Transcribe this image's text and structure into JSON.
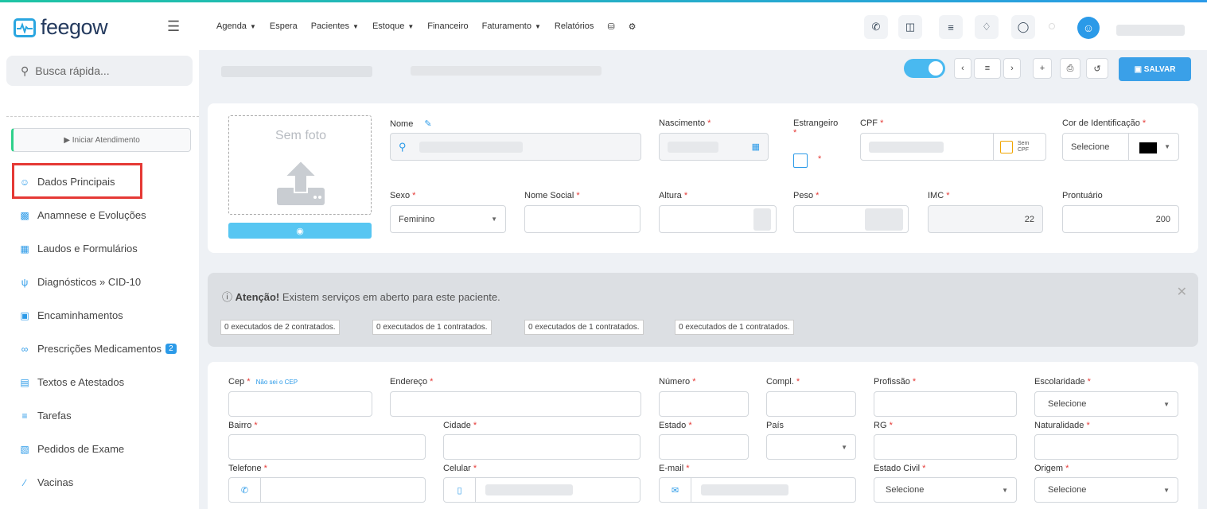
{
  "app": {
    "logo": "feegow",
    "accent": "#2b9ae8"
  },
  "sidebar": {
    "search_placeholder": "Busca rápida...",
    "start_button": "▶ Iniciar Atendimento",
    "items": [
      {
        "label": "Dados Principais",
        "icon": "user-icon"
      },
      {
        "label": "Anamnese e Evoluções",
        "icon": "chart-icon"
      },
      {
        "label": "Laudos e Formulários",
        "icon": "clipboard-icon"
      },
      {
        "label": "Diagnósticos » CID-10",
        "icon": "stethoscope-icon"
      },
      {
        "label": "Encaminhamentos",
        "icon": "file-icon"
      },
      {
        "label": "Prescrições Medicamentos",
        "icon": "pills-icon",
        "badge": "2"
      },
      {
        "label": "Textos e Atestados",
        "icon": "document-icon"
      },
      {
        "label": "Tarefas",
        "icon": "tasks-icon"
      },
      {
        "label": "Pedidos de Exame",
        "icon": "exam-icon"
      },
      {
        "label": "Vacinas",
        "icon": "syringe-icon"
      }
    ]
  },
  "topnav": {
    "items": [
      "Agenda",
      "Espera",
      "Pacientes",
      "Estoque",
      "Financeiro",
      "Faturamento",
      "Relatórios"
    ],
    "dropdown_flags": [
      true,
      false,
      true,
      true,
      false,
      true,
      false
    ]
  },
  "header": {
    "save_label": "SALVAR"
  },
  "form": {
    "photo_label": "Sem foto",
    "nome": "Nome",
    "nascimento": "Nascimento",
    "estrangeiro": "Estrangeiro",
    "cpf": "CPF",
    "sem_cpf": "Sem CPF",
    "cor": "Cor de Identificação",
    "cor_value": "Selecione",
    "sexo": "Sexo",
    "sexo_value": "Feminino",
    "nome_social": "Nome Social",
    "altura": "Altura",
    "peso": "Peso",
    "imc": "IMC",
    "imc_value": "22",
    "prontuario": "Prontuário",
    "prontuario_value": "200"
  },
  "alert": {
    "strong": "Atenção!",
    "text": " Existem serviços em aberto para este paciente.",
    "chips": [
      "0 executados de 2 contratados.",
      "0 executados de 1 contratados.",
      "0 executados de 1 contratados.",
      "0 executados de 1 contratados."
    ]
  },
  "address": {
    "cep": "Cep",
    "nao_sei": "Não sei o CEP",
    "endereco": "Endereço",
    "numero": "Número",
    "compl": "Compl.",
    "profissao": "Profissão",
    "escolaridade": "Escolaridade",
    "selecione": "Selecione",
    "bairro": "Bairro",
    "cidade": "Cidade",
    "estado": "Estado",
    "pais": "País",
    "rg": "RG",
    "naturalidade": "Naturalidade",
    "telefone": "Telefone",
    "celular": "Celular",
    "email": "E-mail",
    "estado_civil": "Estado Civil",
    "origem": "Origem"
  }
}
